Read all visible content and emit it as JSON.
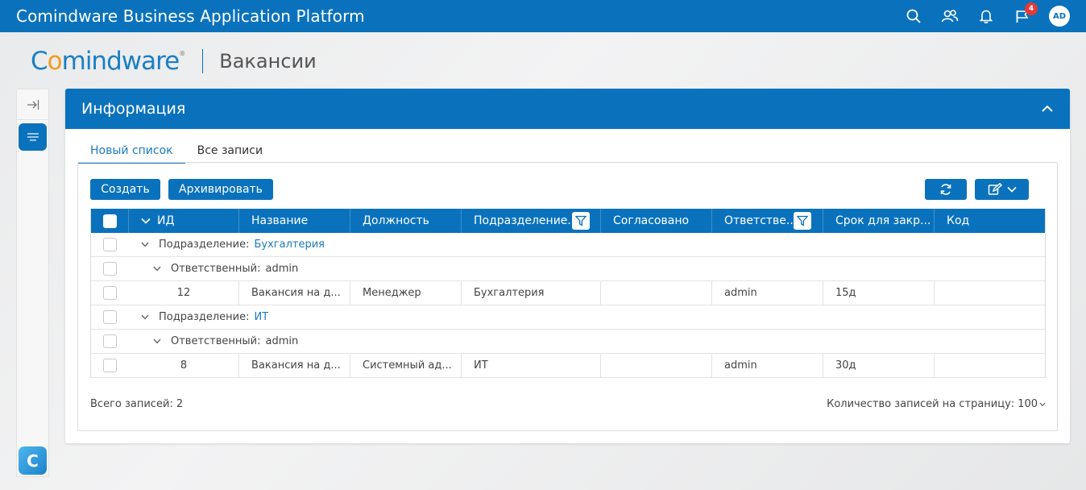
{
  "app": {
    "title": "Comindware Business Application Platform",
    "notifications_badge": "4",
    "avatar_initials": "AD"
  },
  "logo": {
    "text_a": "C",
    "text_o": "o",
    "text_b": "mindware",
    "reg": "®"
  },
  "page": {
    "title": "Вакансии"
  },
  "card": {
    "title": "Информация"
  },
  "tabs": [
    {
      "label": "Новый список"
    },
    {
      "label": "Все записи"
    }
  ],
  "toolbar": {
    "create_label": "Создать",
    "archive_label": "Архивировать"
  },
  "columns": [
    {
      "label": "ИД"
    },
    {
      "label": "Название"
    },
    {
      "label": "Должность"
    },
    {
      "label": "Подразделение..."
    },
    {
      "label": "Согласовано"
    },
    {
      "label": "Ответстве..."
    },
    {
      "label": "Срок для закр..."
    },
    {
      "label": "Код"
    }
  ],
  "groups": [
    {
      "field_label": "Подразделение:",
      "value": "Бухгалтерия",
      "sub": {
        "field_label": "Ответственный:",
        "value": "admin"
      },
      "row": {
        "id": "12",
        "name": "Вакансия на д...",
        "position": "Менеджер",
        "department": "Бухгалтерия",
        "approved": "",
        "responsible": "admin",
        "deadline": "15д",
        "code": ""
      }
    },
    {
      "field_label": "Подразделение:",
      "value": "ИТ",
      "sub": {
        "field_label": "Ответственный:",
        "value": "admin"
      },
      "row": {
        "id": "8",
        "name": "Вакансия на д...",
        "position": "Системный ад...",
        "department": "ИТ",
        "approved": "",
        "responsible": "admin",
        "deadline": "30д",
        "code": ""
      }
    }
  ],
  "footer": {
    "total_label": "Всего записей: 2",
    "per_page_label": "Количество записей на страницу:",
    "per_page_value": "100"
  },
  "colors": {
    "primary": "#0a72bd",
    "link": "#1a7bc0",
    "badge": "#e53935",
    "logo_orange": "#f39c1e"
  }
}
